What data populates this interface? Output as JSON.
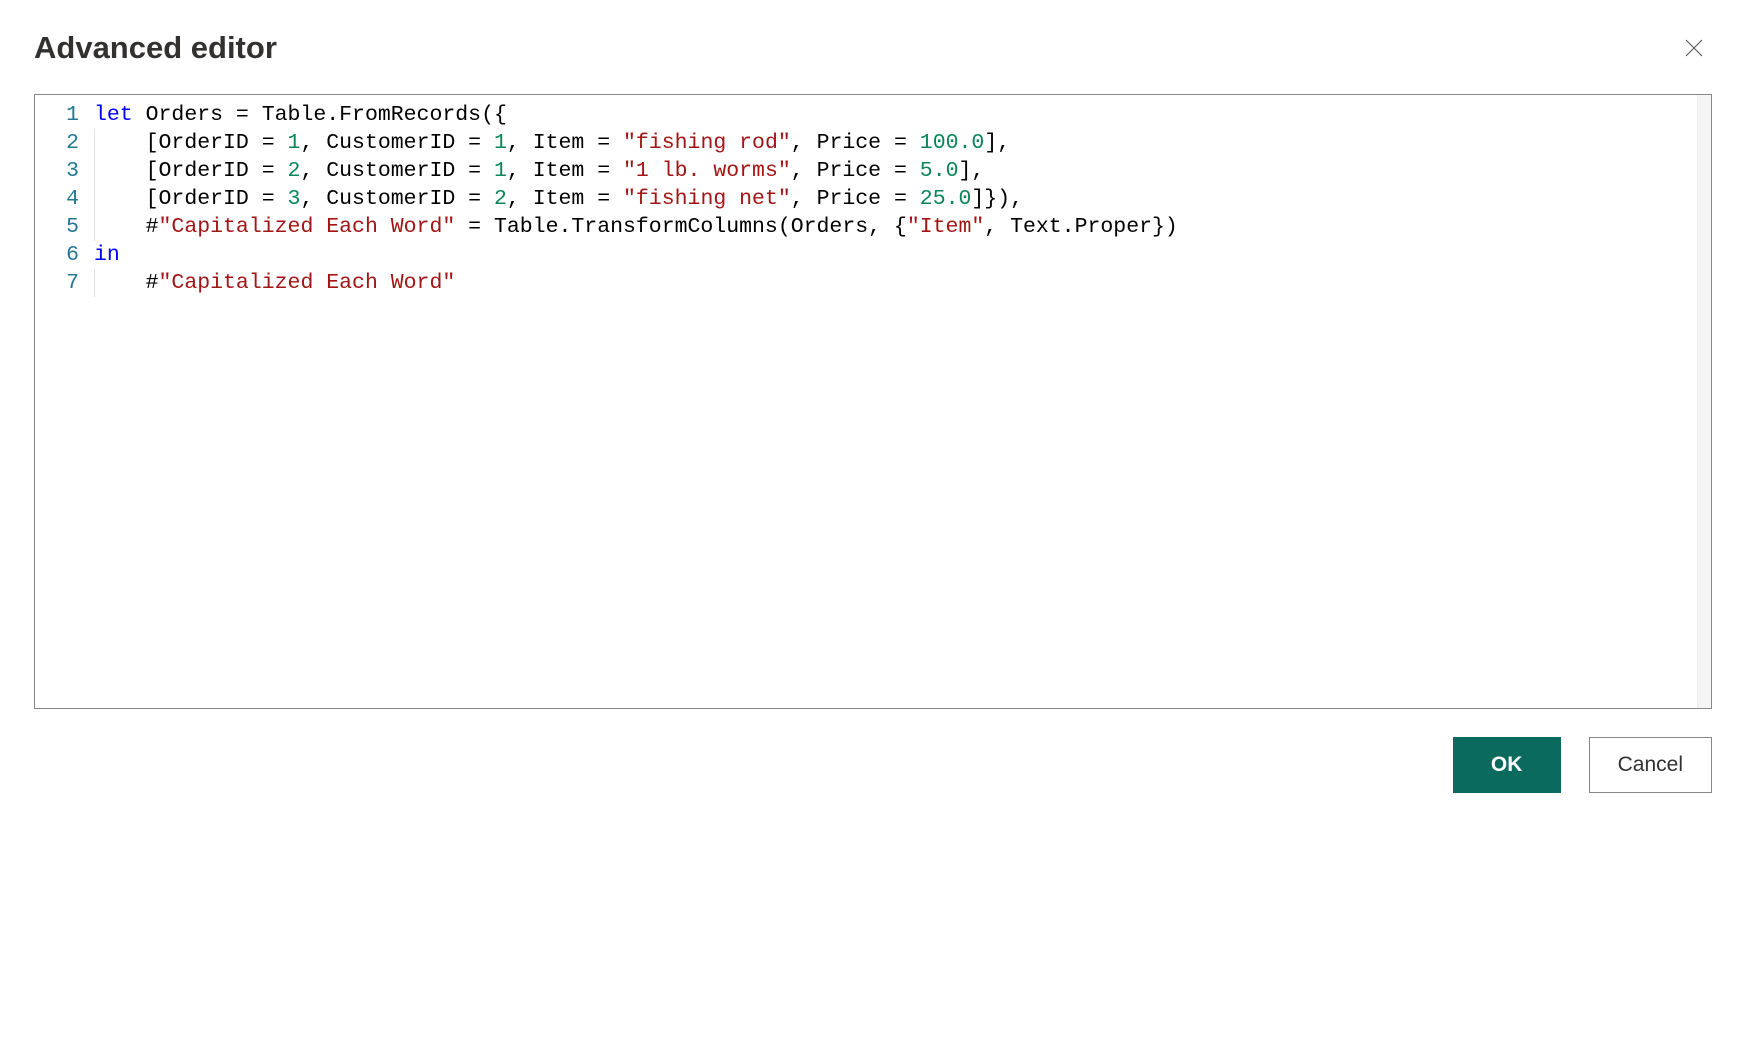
{
  "header": {
    "title": "Advanced editor"
  },
  "editor": {
    "lines": [
      {
        "num": "1",
        "tokens": [
          {
            "t": "let ",
            "c": "tok-keyword"
          },
          {
            "t": "Orders = Table.FromRecords({",
            "c": "tok-text"
          }
        ]
      },
      {
        "num": "2",
        "indent": "    ",
        "tokens": [
          {
            "t": "[OrderID = ",
            "c": "tok-text"
          },
          {
            "t": "1",
            "c": "tok-number"
          },
          {
            "t": ", CustomerID = ",
            "c": "tok-text"
          },
          {
            "t": "1",
            "c": "tok-number"
          },
          {
            "t": ", Item = ",
            "c": "tok-text"
          },
          {
            "t": "\"fishing rod\"",
            "c": "tok-string"
          },
          {
            "t": ", Price = ",
            "c": "tok-text"
          },
          {
            "t": "100.0",
            "c": "tok-number"
          },
          {
            "t": "],",
            "c": "tok-text"
          }
        ]
      },
      {
        "num": "3",
        "indent": "    ",
        "tokens": [
          {
            "t": "[OrderID = ",
            "c": "tok-text"
          },
          {
            "t": "2",
            "c": "tok-number"
          },
          {
            "t": ", CustomerID = ",
            "c": "tok-text"
          },
          {
            "t": "1",
            "c": "tok-number"
          },
          {
            "t": ", Item = ",
            "c": "tok-text"
          },
          {
            "t": "\"1 lb. worms\"",
            "c": "tok-string"
          },
          {
            "t": ", Price = ",
            "c": "tok-text"
          },
          {
            "t": "5.0",
            "c": "tok-number"
          },
          {
            "t": "],",
            "c": "tok-text"
          }
        ]
      },
      {
        "num": "4",
        "indent": "    ",
        "tokens": [
          {
            "t": "[OrderID = ",
            "c": "tok-text"
          },
          {
            "t": "3",
            "c": "tok-number"
          },
          {
            "t": ", CustomerID = ",
            "c": "tok-text"
          },
          {
            "t": "2",
            "c": "tok-number"
          },
          {
            "t": ", Item = ",
            "c": "tok-text"
          },
          {
            "t": "\"fishing net\"",
            "c": "tok-string"
          },
          {
            "t": ", Price = ",
            "c": "tok-text"
          },
          {
            "t": "25.0",
            "c": "tok-number"
          },
          {
            "t": "]}),",
            "c": "tok-text"
          }
        ]
      },
      {
        "num": "5",
        "indent": "    ",
        "tokens": [
          {
            "t": "#",
            "c": "tok-text"
          },
          {
            "t": "\"Capitalized Each Word\"",
            "c": "tok-string"
          },
          {
            "t": " = Table.TransformColumns(Orders, {",
            "c": "tok-text"
          },
          {
            "t": "\"Item\"",
            "c": "tok-string"
          },
          {
            "t": ", Text.Proper})",
            "c": "tok-text"
          }
        ]
      },
      {
        "num": "6",
        "tokens": [
          {
            "t": "in",
            "c": "tok-keyword"
          }
        ]
      },
      {
        "num": "7",
        "indent": "    ",
        "tokens": [
          {
            "t": "#",
            "c": "tok-text"
          },
          {
            "t": "\"Capitalized Each Word\"",
            "c": "tok-string"
          }
        ]
      }
    ]
  },
  "buttons": {
    "ok": "OK",
    "cancel": "Cancel"
  }
}
